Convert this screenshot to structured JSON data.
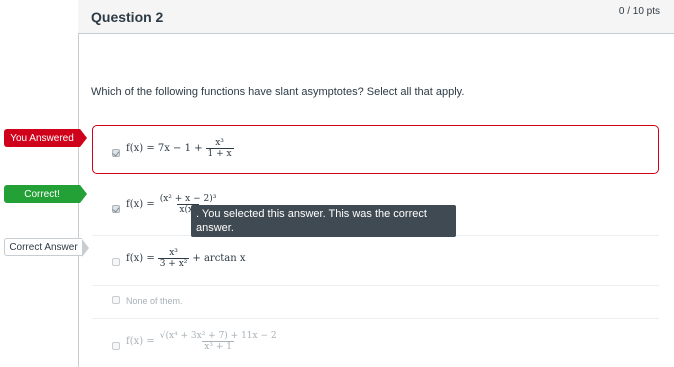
{
  "question": {
    "title": "Question 2",
    "points": "0 / 10 pts",
    "prompt": "Which of the following functions have slant asymptotes? Select all that apply."
  },
  "tags": {
    "you_answered": "You Answered",
    "correct": "Correct!",
    "correct_answer": "Correct Answer"
  },
  "tooltip": ". You selected this answer. This was the correct answer.",
  "answers": [
    {
      "lhs": "f(x) = 7x − 1 +",
      "num": "x³",
      "den": "1 + x",
      "rhs": "",
      "selected": true
    },
    {
      "lhs": "f(x) =",
      "num": "(x² + x − 2)³",
      "den": "x(x²",
      "rhs": "",
      "selected": true
    },
    {
      "lhs": "f(x) =",
      "num": "x³",
      "den": "3 + x²",
      "rhs": "+ arctan x",
      "selected": false
    },
    {
      "text": "None of them.",
      "selected": false
    },
    {
      "lhs": "f(x) =",
      "num": "√(x⁴ + 3x² + 7) + 11x − 2",
      "den": "x³ + 1",
      "rhs": "",
      "selected": false
    }
  ],
  "colors": {
    "wrong": "#d0021b",
    "correct": "#23a036",
    "tooltip": "#404a52"
  }
}
